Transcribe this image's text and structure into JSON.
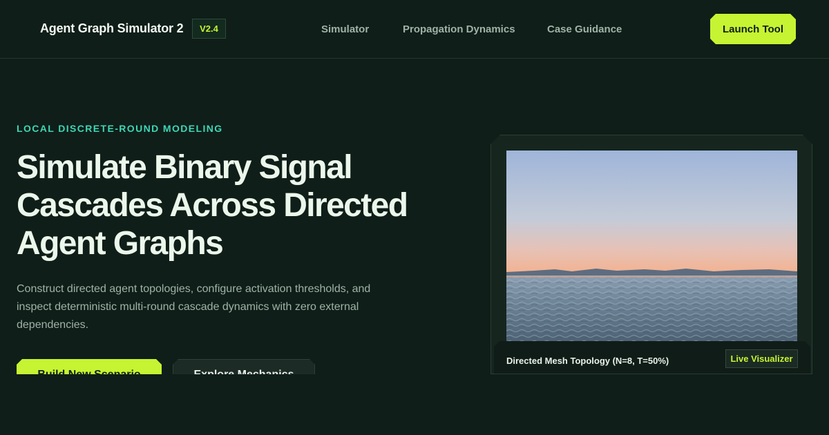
{
  "header": {
    "brand": "Agent Graph Simulator 2",
    "version": "V2.4",
    "nav": [
      "Simulator",
      "Propagation Dynamics",
      "Case Guidance"
    ],
    "launch_label": "Launch Tool"
  },
  "hero": {
    "eyebrow": "LOCAL DISCRETE-ROUND MODELING",
    "title": "Simulate Binary Signal Cascades Across Directed Agent Graphs",
    "subtitle": "Construct directed agent topologies, configure activation thresholds, and inspect deterministic multi-round cascade dynamics with zero external dependencies.",
    "primary_cta": "Build New Scenario",
    "secondary_cta": "Explore Mechanics"
  },
  "visual": {
    "image_subject": "sunset-lake-landscape",
    "caption": "Directed Mesh Topology (N=8, T=50%)",
    "badge": "Live Visualizer"
  },
  "colors": {
    "background": "#0f1e18",
    "accent_lime": "#c6f432",
    "accent_teal": "#3fd6b6",
    "muted_text": "#9fb3a7"
  }
}
